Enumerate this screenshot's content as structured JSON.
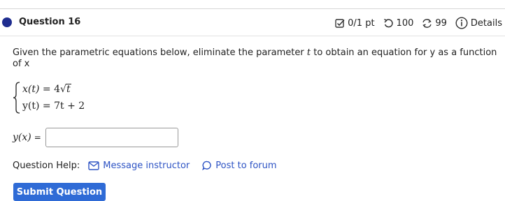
{
  "header": {
    "question_title": "Question 16",
    "score": "0/1 pt",
    "attempts": "100",
    "tries": "99",
    "details_label": "Details"
  },
  "problem": {
    "prompt_before": "Given the parametric equations below, eliminate the parameter ",
    "prompt_var": "t",
    "prompt_after": " to obtain an equation for y as a function of x",
    "eq1_lhs": "x(t)",
    "eq1_coef": "4",
    "eq1_radicand": "t",
    "eq2": "y(t) = 7t + 2"
  },
  "answer": {
    "label": "y(x)",
    "equals": "=",
    "value": ""
  },
  "help": {
    "label": "Question Help:",
    "message_link": "Message instructor",
    "forum_link": "Post to forum"
  },
  "submit": {
    "label": "Submit Question"
  },
  "colors": {
    "accent": "#1f2d8f",
    "link": "#2d53c4",
    "button": "#2f6bd6"
  }
}
